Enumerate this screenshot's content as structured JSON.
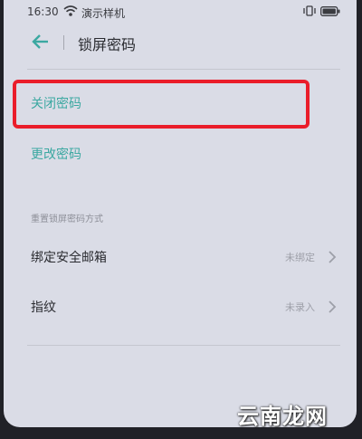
{
  "status_bar": {
    "time": "16:30",
    "carrier": "演示样机",
    "icons": [
      "wifi-icon",
      "vibrate-icon",
      "battery-icon"
    ]
  },
  "header": {
    "back_icon": "arrow-left-icon",
    "title": "锁屏密码"
  },
  "actions": {
    "disable_password": "关闭密码",
    "change_password": "更改密码"
  },
  "reset_section": {
    "label": "重置锁屏密码方式",
    "items": [
      {
        "title": "绑定安全邮箱",
        "value": "未绑定",
        "icon": "chevron-right-icon"
      },
      {
        "title": "指纹",
        "value": "未录入",
        "icon": "chevron-right-icon"
      }
    ]
  },
  "watermark": "云南龙网",
  "colors": {
    "accent": "#3ba8a1",
    "highlight": "#ea1d2a",
    "screen_bg": "#dadce6"
  }
}
